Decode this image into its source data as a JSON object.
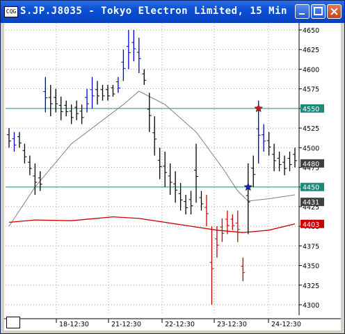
{
  "window": {
    "title": "S.JP.J8035 - Tokyo Electron Limited, 15 Min",
    "app_icon_text": "CQG",
    "buttons": [
      "minimize",
      "maximize",
      "close"
    ]
  },
  "colors": {
    "bar_up": "#0000cc",
    "bar_neutral": "#000000",
    "bar_down": "#cc0000",
    "ma_fast": "#808080",
    "ma_slow": "#cc0000",
    "hline": "#2e8b7a",
    "grid": "#a0a0a0"
  },
  "chart_data": {
    "type": "candlestick_bar",
    "symbol": "S.JP.J8035",
    "interval": "15 Min",
    "ylim": [
      4290,
      4660
    ],
    "yticks": [
      4300,
      4325,
      4350,
      4375,
      4400,
      4425,
      4450,
      4475,
      4500,
      4525,
      4550,
      4575,
      4600,
      4625,
      4650
    ],
    "ytick_labels": [
      "4300",
      "4325",
      "4350",
      "4375",
      "4400",
      "4425",
      "4450",
      "4475",
      "4500",
      "4525",
      "4550",
      "4575",
      "4600",
      "4625",
      "4650"
    ],
    "xtick_labels": [
      "18-12:30",
      "21-12:30",
      "22-12:30",
      "23-12:30",
      "24-12:30"
    ],
    "price_tags": [
      {
        "label": "4550",
        "value": 4550,
        "style": "teal"
      },
      {
        "label": "4480",
        "value": 4480,
        "style": "dark"
      },
      {
        "label": "4450",
        "value": 4450,
        "style": "teal"
      },
      {
        "label": "4431",
        "value": 4431,
        "style": "dark"
      },
      {
        "label": "4403",
        "value": 4403,
        "style": "red"
      }
    ],
    "horizontal_lines": [
      4550,
      4450
    ],
    "markers": [
      {
        "type": "star",
        "color": "red",
        "value": 4550,
        "bar_index": 48
      },
      {
        "type": "star",
        "color": "blue",
        "value": 4450,
        "bar_index": 46
      }
    ],
    "bars": [
      [
        4500,
        4525,
        "k"
      ],
      [
        4495,
        4520,
        "b"
      ],
      [
        4500,
        4520,
        "k"
      ],
      [
        4480,
        4505,
        "k"
      ],
      [
        4465,
        4490,
        "k"
      ],
      [
        4440,
        4480,
        "k"
      ],
      [
        4445,
        4470,
        "k"
      ],
      [
        4545,
        4590,
        "b"
      ],
      [
        4540,
        4580,
        "k"
      ],
      [
        4545,
        4575,
        "k"
      ],
      [
        4535,
        4565,
        "k"
      ],
      [
        4540,
        4560,
        "k"
      ],
      [
        4530,
        4555,
        "k"
      ],
      [
        4535,
        4560,
        "k"
      ],
      [
        4530,
        4555,
        "k"
      ],
      [
        4545,
        4575,
        "b"
      ],
      [
        4550,
        4590,
        "b"
      ],
      [
        4555,
        4585,
        "k"
      ],
      [
        4560,
        4580,
        "k"
      ],
      [
        4560,
        4580,
        "k"
      ],
      [
        4565,
        4580,
        "k"
      ],
      [
        4570,
        4590,
        "b"
      ],
      [
        4585,
        4625,
        "b"
      ],
      [
        4600,
        4650,
        "b"
      ],
      [
        4610,
        4650,
        "b"
      ],
      [
        4595,
        4640,
        "b"
      ],
      [
        4580,
        4600,
        "k"
      ],
      [
        4520,
        4570,
        "k"
      ],
      [
        4490,
        4540,
        "k"
      ],
      [
        4460,
        4500,
        "k"
      ],
      [
        4450,
        4495,
        "k"
      ],
      [
        4440,
        4480,
        "k"
      ],
      [
        4430,
        4470,
        "k"
      ],
      [
        4420,
        4455,
        "k"
      ],
      [
        4415,
        4440,
        "k"
      ],
      [
        4415,
        4445,
        "k"
      ],
      [
        4430,
        4505,
        "k"
      ],
      [
        4420,
        4445,
        "k"
      ],
      [
        4400,
        4440,
        "r"
      ],
      [
        4300,
        4400,
        "r"
      ],
      [
        4360,
        4400,
        "r"
      ],
      [
        4380,
        4410,
        "r"
      ],
      [
        4390,
        4420,
        "r"
      ],
      [
        4395,
        4415,
        "r"
      ],
      [
        4380,
        4420,
        "r"
      ],
      [
        4330,
        4360,
        "r"
      ],
      [
        4390,
        4480,
        "k"
      ],
      [
        4450,
        4490,
        "k"
      ],
      [
        4480,
        4560,
        "b"
      ],
      [
        4495,
        4530,
        "b"
      ],
      [
        4490,
        4520,
        "k"
      ],
      [
        4470,
        4505,
        "k"
      ],
      [
        4470,
        4495,
        "k"
      ],
      [
        4465,
        4490,
        "k"
      ],
      [
        4470,
        4495,
        "k"
      ],
      [
        4475,
        4500,
        "k"
      ]
    ],
    "ma_fast_path": [
      [
        0,
        4400
      ],
      [
        5,
        4450
      ],
      [
        12,
        4505
      ],
      [
        22,
        4555
      ],
      [
        25,
        4572
      ],
      [
        30,
        4555
      ],
      [
        36,
        4520
      ],
      [
        41,
        4475
      ],
      [
        44,
        4445
      ],
      [
        46,
        4432
      ],
      [
        50,
        4435
      ],
      [
        55,
        4440
      ]
    ],
    "ma_slow_path": [
      [
        0,
        4405
      ],
      [
        5,
        4408
      ],
      [
        12,
        4407
      ],
      [
        20,
        4412
      ],
      [
        25,
        4410
      ],
      [
        33,
        4402
      ],
      [
        40,
        4395
      ],
      [
        45,
        4392
      ],
      [
        50,
        4395
      ],
      [
        55,
        4403
      ]
    ],
    "bottom_box_label": ""
  }
}
